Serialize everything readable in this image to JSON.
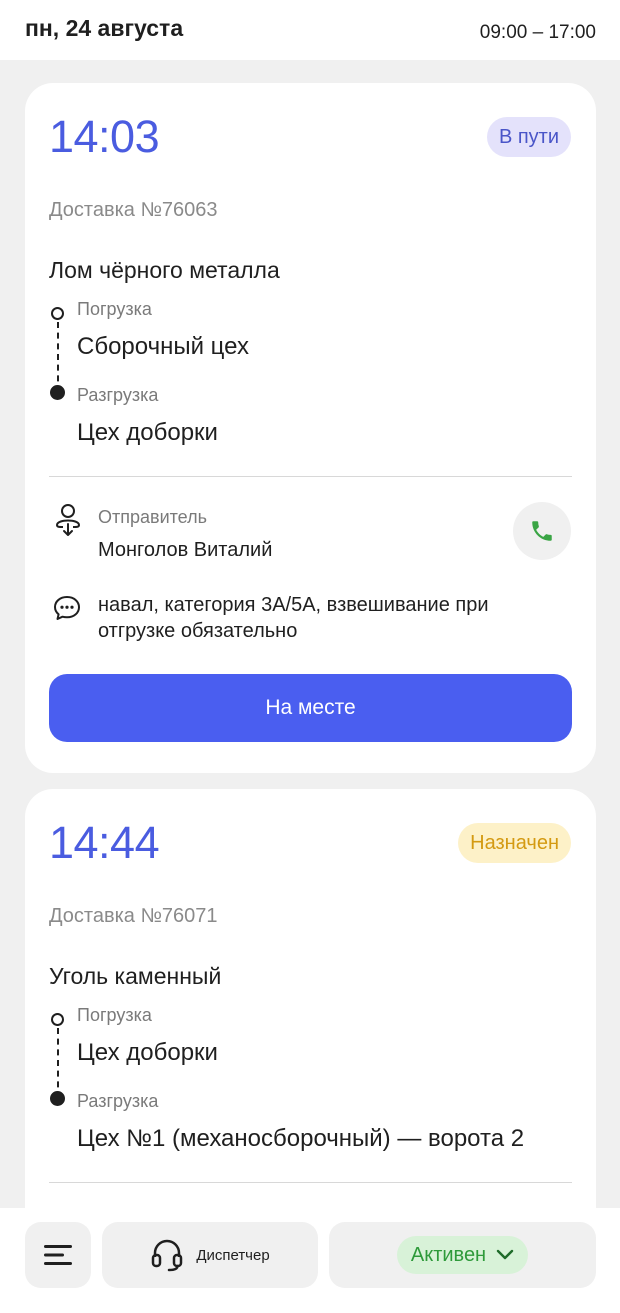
{
  "header": {
    "date": "пн, 24 августа",
    "hours": "09:00 – 17:00"
  },
  "orders": [
    {
      "time": "14:03",
      "status": "В пути",
      "delivery": "Доставка №76063",
      "cargo": "Лом чёрного металла",
      "loading_label": "Погрузка",
      "loading_place": "Сборочный цех",
      "unloading_label": "Разгрузка",
      "unloading_place": "Цех доборки",
      "sender_label": "Отправитель",
      "sender_name": "Монголов Виталий",
      "comment": "навал, категория 3А/5А, взвешивание при отгрузке обязательно",
      "action": "На месте"
    },
    {
      "time": "14:44",
      "status": "Назначен",
      "delivery": "Доставка №76071",
      "cargo": "Уголь каменный",
      "loading_label": "Погрузка",
      "loading_place": "Цех доборки",
      "unloading_label": "Разгрузка",
      "unloading_place": "Цех №1 (механосборочный) — ворота 2"
    }
  ],
  "bottom_bar": {
    "menu_icon": "hamburger-menu-icon",
    "dispatcher_icon": "headset-icon",
    "dispatcher_label": "Диспетчер",
    "status_label": "Активен",
    "status_icon": "chevron-down-icon"
  },
  "colors": {
    "accent": "#4a5ef0",
    "time": "#4a5ce0",
    "in_transit_bg": "#e4e2fb",
    "assigned_bg": "#fdf1c8",
    "active_bg": "#d8f2d8",
    "active_text": "#2e9a3a",
    "call_green": "#3aa545"
  }
}
